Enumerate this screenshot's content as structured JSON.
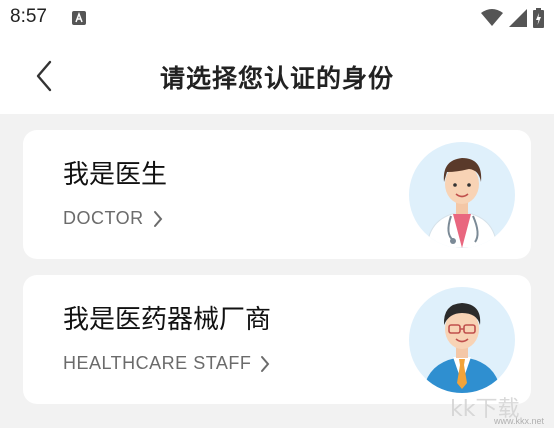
{
  "status_bar": {
    "time": "8:57"
  },
  "header": {
    "title": "请选择您认证的身份"
  },
  "cards": [
    {
      "title": "我是医生",
      "subtitle": "DOCTOR",
      "avatar_icon": "doctor-avatar"
    },
    {
      "title": "我是医药器械厂商",
      "subtitle": "HEALTHCARE STAFF",
      "avatar_icon": "staff-avatar"
    }
  ],
  "watermark": {
    "logo": "kk下载",
    "url": "www.kkx.net"
  },
  "colors": {
    "background": "#f2f2f2",
    "card": "#ffffff",
    "avatar_bg": "#dff0fb"
  }
}
